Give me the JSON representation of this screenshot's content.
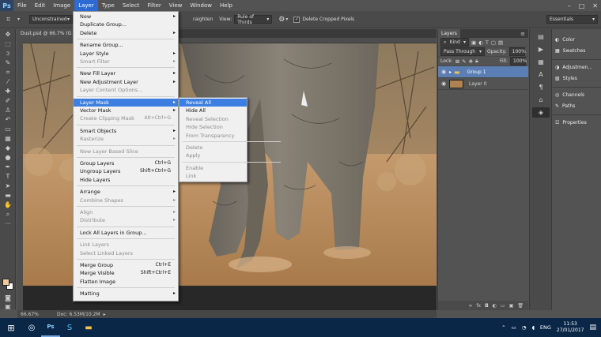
{
  "menubar": {
    "logo": "Ps",
    "items": [
      "File",
      "Edit",
      "Image",
      "Layer",
      "Type",
      "Select",
      "Filter",
      "View",
      "Window",
      "Help"
    ],
    "window_controls": [
      "–",
      "□",
      "✕"
    ]
  },
  "options_bar": {
    "ratio": "Unconstrained",
    "straighten_partial": "raighten",
    "view_label": "View:",
    "view_value": "Rule of Thirds",
    "delete_cropped_label": "Delete Cropped Pixels",
    "workspace": "Essentials"
  },
  "document_tab": {
    "title": "Dust.psd @ 66.7% (G"
  },
  "status_bar": {
    "zoom": "66.67%",
    "doc_info": "Doc: 6.53M/10.2M"
  },
  "layer_menu": {
    "items": [
      {
        "label": "New",
        "submenu": true,
        "disabled": false
      },
      {
        "label": "Duplicate Group...",
        "disabled": false
      },
      {
        "label": "Delete",
        "submenu": true,
        "disabled": false
      },
      {
        "sep": true
      },
      {
        "label": "Rename Group...",
        "disabled": false
      },
      {
        "label": "Layer Style",
        "submenu": true,
        "disabled": false
      },
      {
        "label": "Smart Filter",
        "submenu": true,
        "disabled": true
      },
      {
        "sep": true
      },
      {
        "label": "New Fill Layer",
        "submenu": true,
        "disabled": false
      },
      {
        "label": "New Adjustment Layer",
        "submenu": true,
        "disabled": false
      },
      {
        "label": "Layer Content Options...",
        "disabled": true
      },
      {
        "sep": true
      },
      {
        "label": "Layer Mask",
        "submenu": true,
        "disabled": false,
        "highlighted": true
      },
      {
        "label": "Vector Mask",
        "submenu": true,
        "disabled": false
      },
      {
        "label": "Create Clipping Mask",
        "shortcut": "Alt+Ctrl+G",
        "disabled": true
      },
      {
        "sep": true
      },
      {
        "label": "Smart Objects",
        "submenu": true,
        "disabled": false
      },
      {
        "label": "Rasterize",
        "submenu": true,
        "disabled": true
      },
      {
        "sep": true
      },
      {
        "label": "New Layer Based Slice",
        "disabled": true
      },
      {
        "sep": true
      },
      {
        "label": "Group Layers",
        "shortcut": "Ctrl+G",
        "disabled": false
      },
      {
        "label": "Ungroup Layers",
        "shortcut": "Shift+Ctrl+G",
        "disabled": false
      },
      {
        "label": "Hide Layers",
        "disabled": false
      },
      {
        "sep": true
      },
      {
        "label": "Arrange",
        "submenu": true,
        "disabled": false
      },
      {
        "label": "Combine Shapes",
        "submenu": true,
        "disabled": true
      },
      {
        "sep": true
      },
      {
        "label": "Align",
        "submenu": true,
        "disabled": true
      },
      {
        "label": "Distribute",
        "submenu": true,
        "disabled": true
      },
      {
        "sep": true
      },
      {
        "label": "Lock All Layers in Group...",
        "disabled": false
      },
      {
        "sep": true
      },
      {
        "label": "Link Layers",
        "disabled": true
      },
      {
        "label": "Select Linked Layers",
        "disabled": true
      },
      {
        "sep": true
      },
      {
        "label": "Merge Group",
        "shortcut": "Ctrl+E",
        "disabled": false
      },
      {
        "label": "Merge Visible",
        "shortcut": "Shift+Ctrl+E",
        "disabled": false
      },
      {
        "label": "Flatten Image",
        "disabled": false
      },
      {
        "sep": true
      },
      {
        "label": "Matting",
        "submenu": true,
        "disabled": false
      }
    ]
  },
  "layer_mask_submenu": {
    "items": [
      {
        "label": "Reveal All",
        "disabled": false,
        "highlighted": true
      },
      {
        "label": "Hide All",
        "disabled": false
      },
      {
        "label": "Reveal Selection",
        "disabled": true
      },
      {
        "label": "Hide Selection",
        "disabled": true
      },
      {
        "label": "From Transparency",
        "disabled": true
      },
      {
        "sep": true
      },
      {
        "label": "Delete",
        "disabled": true
      },
      {
        "label": "Apply",
        "disabled": true
      },
      {
        "sep": true
      },
      {
        "label": "Enable",
        "disabled": true
      },
      {
        "label": "Link",
        "disabled": true
      }
    ]
  },
  "layers_panel": {
    "tab": "Layers",
    "filter_kind": "Kind",
    "blend_mode": "Pass Through",
    "opacity_label": "Opacity:",
    "opacity_value": "100%",
    "lock_label": "Lock:",
    "fill_label": "Fill:",
    "fill_value": "100%",
    "layers": [
      {
        "name": "Group 1",
        "type": "group",
        "selected": true
      },
      {
        "name": "Layer 0",
        "type": "pixel",
        "selected": false
      }
    ],
    "footer_icons": [
      "link-icon",
      "fx-icon",
      "mask-icon",
      "adjustment-icon",
      "folder-icon",
      "new-layer-icon",
      "trash-icon"
    ],
    "footer_fx": "fx"
  },
  "side_panels": [
    {
      "label": "Color",
      "icon": "color-icon"
    },
    {
      "label": "Swatches",
      "icon": "swatches-icon"
    },
    {
      "label": "Adjustmen...",
      "icon": "adjustments-icon"
    },
    {
      "label": "Styles",
      "icon": "styles-icon"
    },
    {
      "label": "Channels",
      "icon": "channels-icon"
    },
    {
      "label": "Paths",
      "icon": "paths-icon"
    },
    {
      "label": "Properties",
      "icon": "properties-icon"
    }
  ],
  "taskbar": {
    "language": "ENG",
    "time": "11:53",
    "date": "27/01/2017"
  },
  "colors": {
    "menu_highlight": "#3d7fe0",
    "foreground_swatch": "#f3c89c",
    "layer_selected": "#5b7fb4"
  }
}
